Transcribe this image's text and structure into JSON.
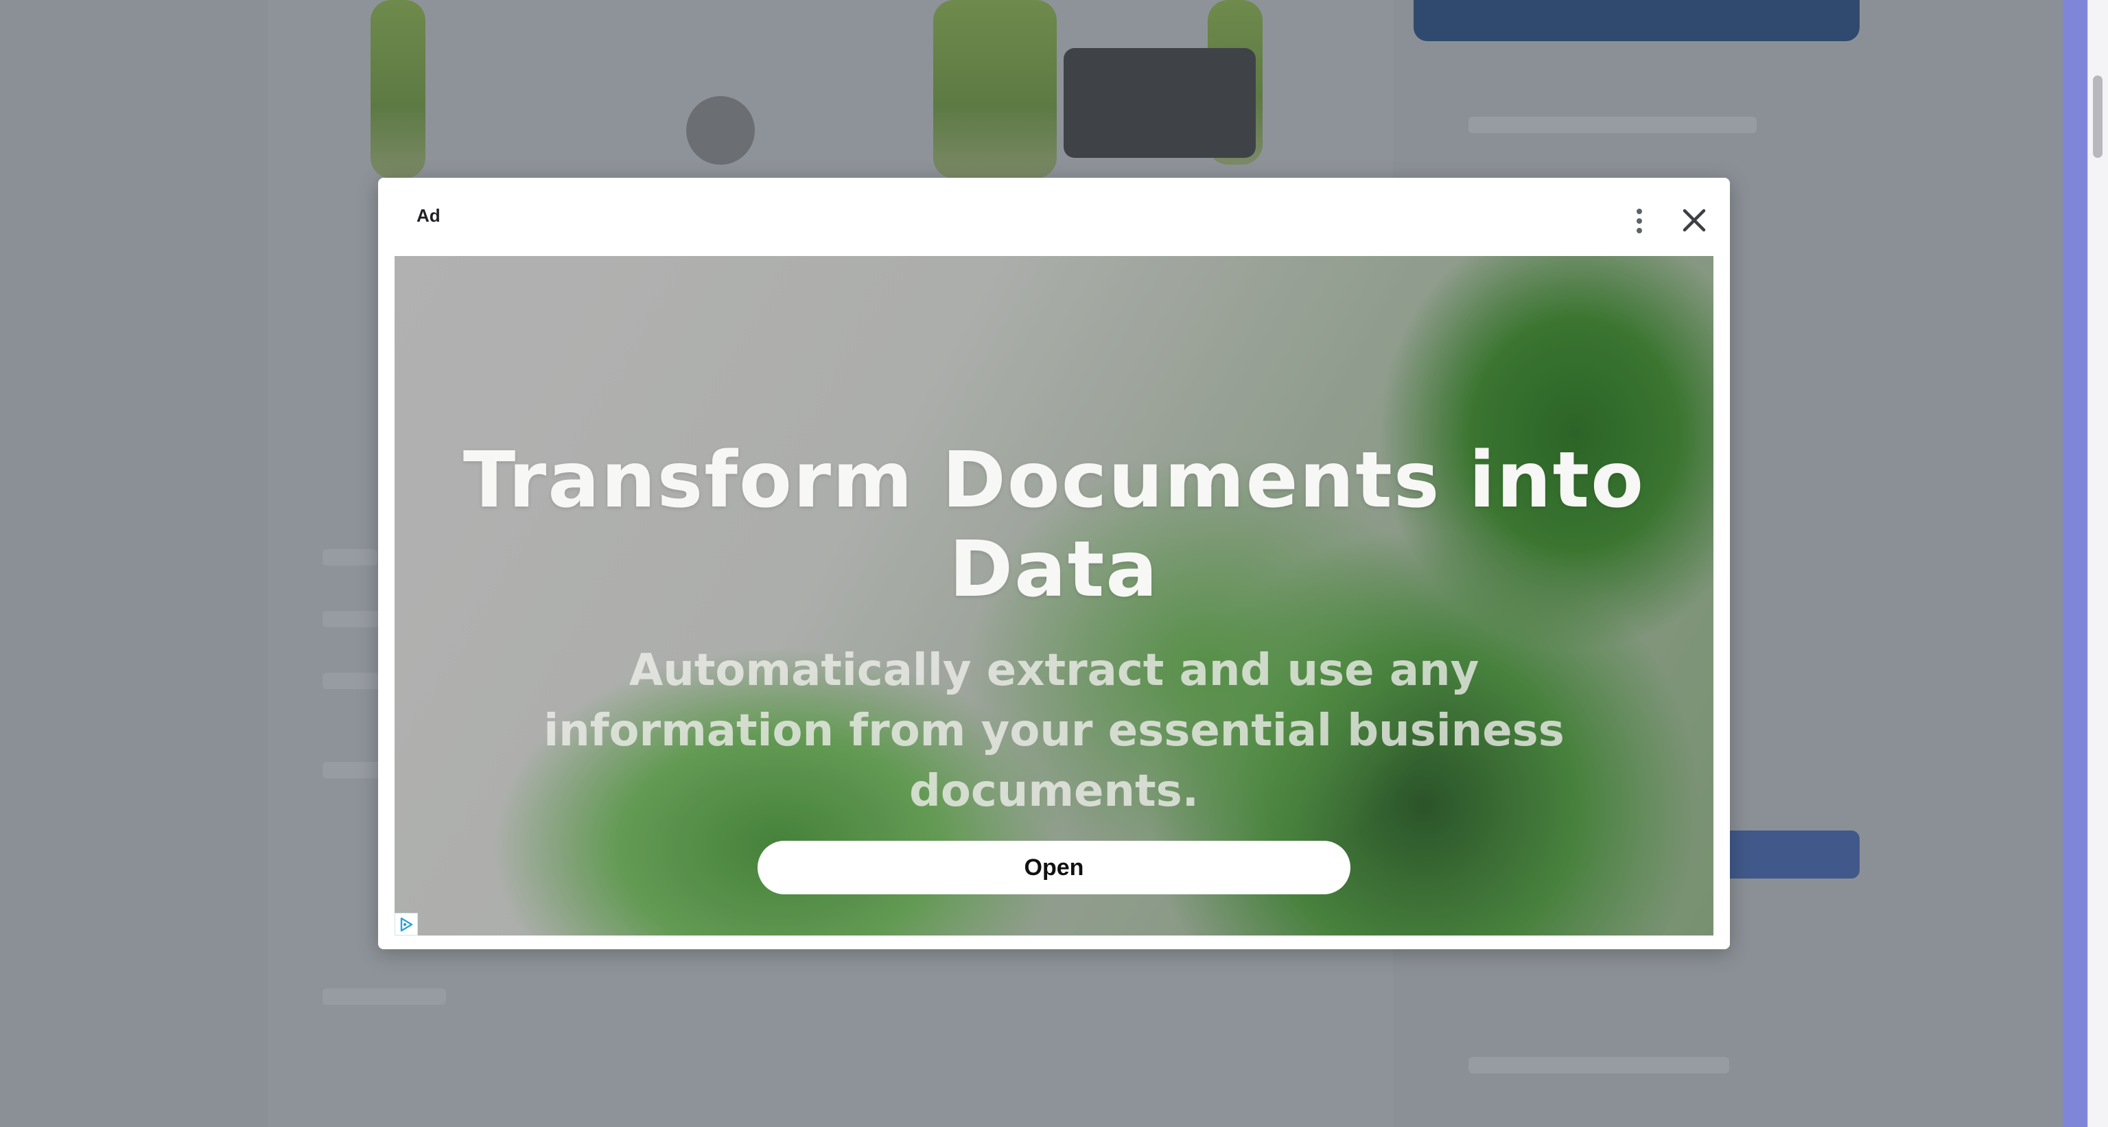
{
  "ad": {
    "label": "Ad",
    "headline": "Transform Documents into Data",
    "subline": "Automatically extract and use any information from your essential business documents.",
    "cta_label": "Open",
    "menu_icon": "more-vert-icon",
    "close_icon": "close-icon",
    "adchoices_icon": "adchoices-icon"
  },
  "colors": {
    "overlay": "#8b9096",
    "dialog": "#ffffff",
    "accent_strip": "#7f86d9"
  }
}
